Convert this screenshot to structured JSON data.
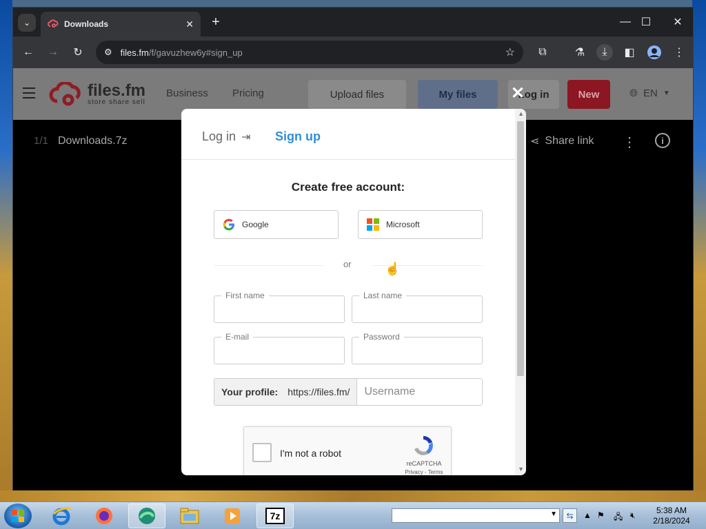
{
  "browser": {
    "tab_title": "Downloads",
    "url_host": "files.fm",
    "url_path": "/f/gavuzhew6y#sign_up"
  },
  "site": {
    "logo_name": "files.fm",
    "logo_tagline": "store share sell",
    "nav": [
      "Business",
      "Pricing"
    ],
    "upload_label": "Upload files",
    "myfiles_label": "My files",
    "login_label": "Log in",
    "new_label": "New",
    "lang_label": "EN"
  },
  "viewer": {
    "counter": "1/1",
    "filename": "Downloads.7z",
    "share_label": "Share link"
  },
  "modal": {
    "tab_login": "Log in",
    "tab_signup": "Sign up",
    "title": "Create free account:",
    "google_label": "Google",
    "microsoft_label": "Microsoft",
    "or_label": "or",
    "first_name_label": "First name",
    "last_name_label": "Last name",
    "email_label": "E-mail",
    "password_label": "Password",
    "profile_label": "Your profile:",
    "profile_prefix": "https://files.fm/",
    "username_placeholder": "Username",
    "captcha_text": "I'm not a robot",
    "captcha_brand": "reCAPTCHA",
    "captcha_links": "Privacy - Terms"
  },
  "taskbar": {
    "time": "5:38 AM",
    "date": "2/18/2024"
  },
  "colors": {
    "signup_accent": "#2f8fd8",
    "new_button": "#8c1622",
    "brand_red": "#d6323c"
  }
}
